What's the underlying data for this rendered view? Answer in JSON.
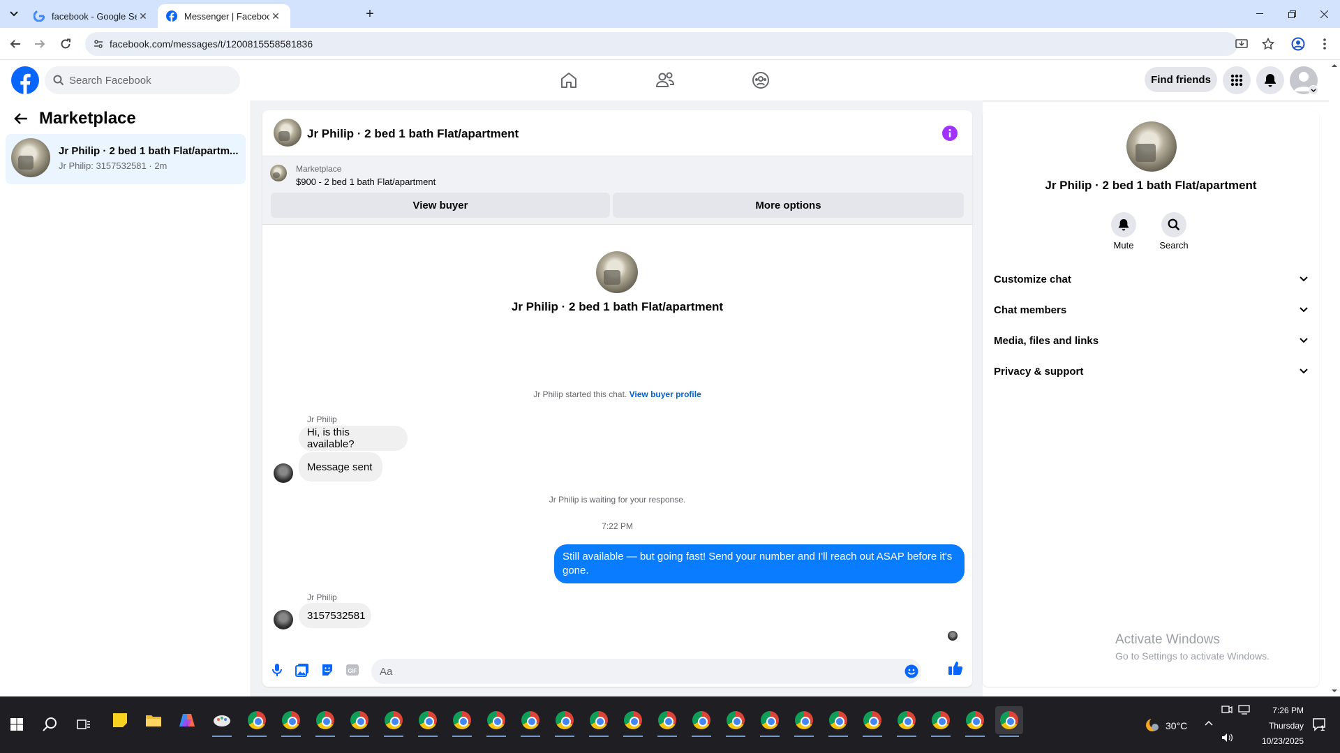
{
  "browser": {
    "tabs": [
      {
        "title": "facebook - Google Search",
        "active": false,
        "icon": "google-icon"
      },
      {
        "title": "Messenger | Facebook",
        "active": true,
        "icon": "facebook-icon"
      }
    ],
    "url": "facebook.com/messages/t/1200815558581836"
  },
  "fb_header": {
    "search_placeholder": "Search Facebook",
    "find_friends": "Find friends"
  },
  "left_panel": {
    "title": "Marketplace",
    "conversations": [
      {
        "title": "Jr Philip · 2 bed 1 bath Flat/apartm...",
        "subtitle": "Jr Philip: 3157532581 · 2m"
      }
    ]
  },
  "chat": {
    "header_title": "Jr Philip · 2 bed 1 bath Flat/apartment",
    "listing": {
      "label": "Marketplace",
      "description": "$900 - 2 bed 1 bath Flat/apartment",
      "view_buyer": "View buyer",
      "more_options": "More options"
    },
    "intro_title": "Jr Philip · 2 bed 1 bath Flat/apartment",
    "started_text": "Jr Philip started this chat.",
    "view_buyer_profile": "View buyer profile",
    "messages": [
      {
        "sender": "Jr Philip",
        "text": "Hi, is this available?"
      },
      {
        "sender": "",
        "text": "Message sent"
      },
      {
        "system": "Jr Philip is waiting for your response."
      },
      {
        "time": "7:22 PM"
      },
      {
        "sender": "me",
        "text": "Still available — but going fast! Send your number and I'll reach out ASAP before it's gone."
      },
      {
        "sender": "Jr Philip",
        "text": "3157532581"
      }
    ],
    "composer_placeholder": "Aa"
  },
  "right_panel": {
    "title": "Jr Philip · 2 bed 1 bath Flat/apartment",
    "mute": "Mute",
    "search": "Search",
    "sections": [
      "Customize chat",
      "Chat members",
      "Media, files and links",
      "Privacy & support"
    ]
  },
  "watermark": {
    "line1": "Activate Windows",
    "line2": "Go to Settings to activate Windows."
  },
  "taskbar": {
    "weather": "30°C",
    "time": "7:26 PM",
    "day": "Thursday",
    "date": "10/23/2025",
    "notification_count": "1"
  },
  "colors": {
    "fb_blue": "#0866ff",
    "messenger_bubble": "#0a7cff",
    "info_purple": "#a033ff"
  }
}
